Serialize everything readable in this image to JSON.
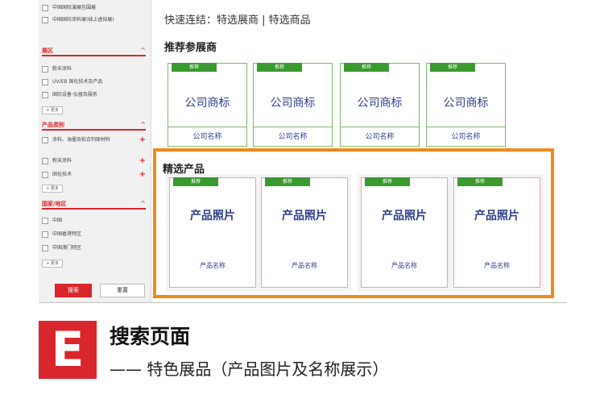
{
  "sidebar": {
    "top_items": [
      "中国国际演展包围展",
      "中国国际涂料展(线上虚拟展)"
    ],
    "groups": [
      {
        "title": "展区",
        "items": [
          "粉末涂料",
          "UV/EB 固化技术及产品",
          "国际设备·仪器及服务"
        ],
        "more": "+ 更多"
      },
      {
        "title": "产品类别",
        "items": [
          "涂料、油墨及粘合剂原材料",
          "粉末涂料",
          "固化技术"
        ],
        "more": "+ 更多"
      },
      {
        "title": "国家/地区",
        "items": [
          "中国",
          "中国香港特区",
          "中国澳门特区"
        ],
        "more": "+ 更多"
      }
    ],
    "plus_symbol": "+",
    "chevron_symbol": "^",
    "search_label": "搜索",
    "reset_label": "重置"
  },
  "main": {
    "quick_links": "快速连结：特选展商 | 特选商品",
    "exhibitors_title": "推荐参展商",
    "exhibitor_tag": "推荐",
    "exhibitor_logo": "公司商标",
    "exhibitor_name": "公司名称",
    "featured_title": "精选产品",
    "product_tag": "推荐",
    "product_photo": "产品照片",
    "product_name": "产品名称"
  },
  "caption": {
    "badge": "E",
    "title": "搜索页面",
    "subtitle": "—— 特色展品（产品图片及名称展示）"
  },
  "colors": {
    "accent_red": "#d9262c",
    "tag_green": "#3a9a2f",
    "highlight_orange": "#f08a1c",
    "text_blue": "#2d3e8c"
  }
}
